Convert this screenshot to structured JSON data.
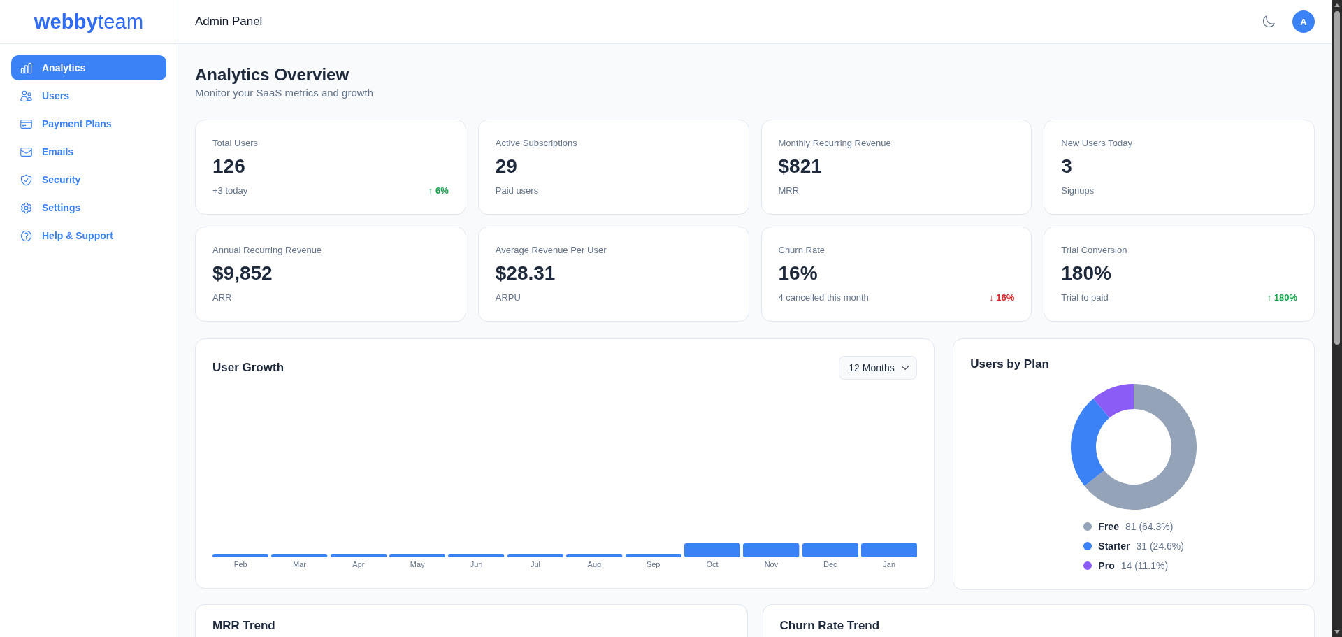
{
  "sidebar": {
    "logo": "**webby**team",
    "items": [
      {
        "label": "Analytics",
        "selected": true
      },
      {
        "label": "Users",
        "selected": false
      },
      {
        "label": "Payment Plans",
        "selected": false
      },
      {
        "label": "Emails",
        "selected": false
      },
      {
        "label": "Security",
        "selected": false
      },
      {
        "label": "Settings",
        "selected": false
      },
      {
        "label": "Help & Support",
        "selected": false
      }
    ]
  },
  "header": {
    "title": "Admin Panel",
    "avatar": "A"
  },
  "page": {
    "title": "Analytics Overview",
    "subtitle": "Monitor your SaaS metrics and growth"
  },
  "metrics": [
    {
      "label": "Total Users",
      "value": "126",
      "note": "+3 today",
      "trend": "↑ 6%",
      "positive": true
    },
    {
      "label": "Active Subscriptions",
      "value": "29",
      "note": "Paid users"
    },
    {
      "label": "Monthly Recurring Revenue",
      "value": "$821",
      "note": "MRR"
    },
    {
      "label": "New Users Today",
      "value": "3",
      "note": "Signups"
    },
    {
      "label": "Annual Recurring Revenue",
      "value": "$9,852",
      "note": "ARR"
    },
    {
      "label": "Average Revenue Per User",
      "value": "$28.31",
      "note": "ARPU"
    },
    {
      "label": "Churn Rate",
      "value": "16%",
      "note": "4 cancelled this month",
      "trend": "↓ 16%",
      "positive": false
    },
    {
      "label": "Trial Conversion",
      "value": "180%",
      "note": "Trial to paid",
      "trend": "↑ 180%",
      "positive": true
    }
  ],
  "user_growth": {
    "title": "User Growth",
    "period": "12 Months",
    "months": [
      "Feb",
      "Mar",
      "Apr",
      "May",
      "Jun",
      "Jul",
      "Aug",
      "Sep",
      "Oct",
      "Nov",
      "Dec",
      "Jan"
    ]
  },
  "users_by_plan": {
    "title": "Users by Plan",
    "chart_data": {
      "type": "donut",
      "categories": [
        "Free",
        "Starter",
        "Pro"
      ],
      "values": [
        64.3,
        24.6,
        11.1
      ]
    },
    "legend": [
      {
        "count": "81 (64.3%)",
        "color": "#94a3b8"
      },
      {
        "count": "31 (24.6%)",
        "color": "#3b82f6"
      },
      {
        "count": "14 (11.1%)",
        "color": "#8b5cf6"
      }
    ]
  },
  "bottom_cards": [
    {
      "title": "MRR Trend"
    },
    {
      "title": "Churn Rate Trend"
    }
  ]
}
